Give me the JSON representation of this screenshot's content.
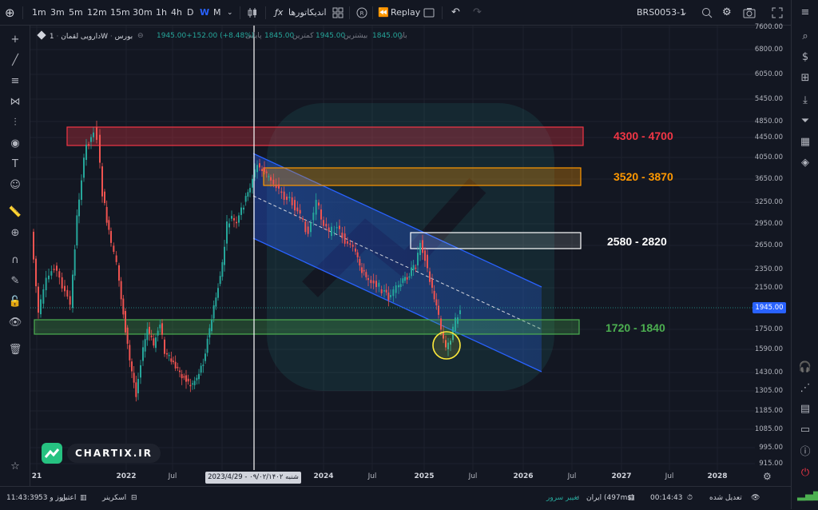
{
  "toolbar": {
    "timeframes": [
      "1m",
      "3m",
      "5m",
      "12m",
      "15m",
      "30m",
      "1h",
      "4h",
      "D",
      "W",
      "M"
    ],
    "active_timeframe": "W",
    "indicators_label": "اندیکاتورها",
    "replay_label": "Replay",
    "symbol": "BRS0053-1"
  },
  "legend": {
    "symbol_text": "دارویی لقمان",
    "interval": "1W",
    "exchange": "بورس",
    "change": "1945.00+152.00 (+8.48%)",
    "close_label": "پایانی",
    "close_value": "1845.00",
    "low_label": "کمترین",
    "low_value": "1945.00",
    "high_label": "بیشترین",
    "high_value": "1845.00",
    "open_label": "باز"
  },
  "price_scale": {
    "ticks": [
      "7600.00",
      "7200.00",
      "6800.00",
      "6450.00",
      "6050.00",
      "5750.00",
      "5450.00",
      "5150.00",
      "4850.00",
      "4450.00",
      "4050.00",
      "3650.00",
      "3250.00",
      "2950.00",
      "2650.00",
      "2350.00",
      "2150.00",
      "1945.00",
      "1750.00",
      "1590.00",
      "1430.00",
      "1305.00",
      "1185.00",
      "1085.00",
      "995.00",
      "915.00"
    ],
    "current_price": "1945.00"
  },
  "time_scale": {
    "ticks": [
      "21",
      "Jul",
      "2022",
      "Jul",
      "Jul",
      "2024",
      "Jul",
      "2025",
      "Jul",
      "2026",
      "Jul",
      "2027",
      "Jul",
      "2028"
    ],
    "cursor_label": "شنبه ۰۹/۰۲/۱۴۰۲ - 2023/4/29"
  },
  "zones": [
    {
      "label": "4300 - 4700",
      "color": "#f23645"
    },
    {
      "label": "3520 - 3870",
      "color": "#ff9800"
    },
    {
      "label": "2580 - 2820",
      "color": "#ffffff"
    },
    {
      "label": "1720 - 1840",
      "color": "#4caf50"
    }
  ],
  "brand": {
    "text": "CHARTIX.IR"
  },
  "bottombar": {
    "time": "11:43:39",
    "credit_label": "اعتبار",
    "credit_value": "53 روز و",
    "screener_label": "اسکرینر",
    "server_change": "تغییر سرور",
    "server": "ایران (497ms)",
    "countdown": "00:14:43",
    "adjusted": "تعدیل شده"
  },
  "colors": {
    "up": "#26a69a",
    "down": "#ef5350",
    "accent": "#2962ff"
  }
}
